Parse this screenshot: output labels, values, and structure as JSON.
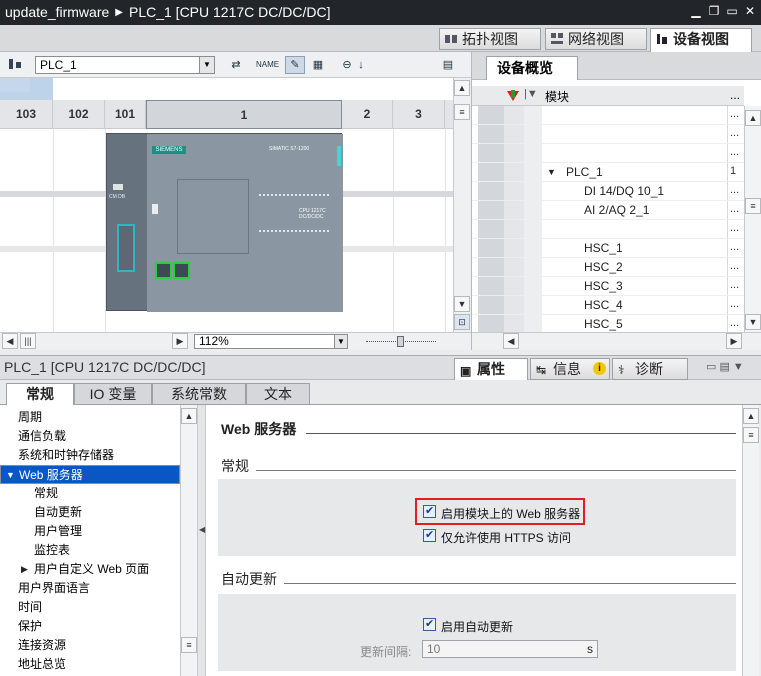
{
  "title_bar": {
    "project": "update_firmware",
    "sep": "▶",
    "device": "PLC_1 [CPU 1217C DC/DC/DC]"
  },
  "view_tabs": [
    {
      "label": "拓扑视图"
    },
    {
      "label": "网络视图"
    },
    {
      "label": "设备视图"
    }
  ],
  "toolbar": {
    "device_select": "PLC_1",
    "zoom": "112%"
  },
  "slots": [
    "103",
    "102",
    "101",
    "1",
    "2",
    "3"
  ],
  "plc_module": {
    "brand": "SIEMENS",
    "model": "SIMATIC S7-1200",
    "cpu_text": "CPU 1217C\nDC/DC/DC"
  },
  "overview": {
    "tab": "设备概览",
    "columns": {
      "module": "模块",
      "more": "..."
    },
    "rows": [
      {
        "name": "",
        "val": "..."
      },
      {
        "name": "",
        "val": "..."
      },
      {
        "name": "",
        "val": "..."
      },
      {
        "name": "PLC_1",
        "val": "1",
        "expand": "▼"
      },
      {
        "name": "DI 14/DQ 10_1",
        "val": "..."
      },
      {
        "name": "AI 2/AQ 2_1",
        "val": "..."
      },
      {
        "name": "",
        "val": "..."
      },
      {
        "name": "HSC_1",
        "val": "..."
      },
      {
        "name": "HSC_2",
        "val": "..."
      },
      {
        "name": "HSC_3",
        "val": "..."
      },
      {
        "name": "HSC_4",
        "val": "..."
      },
      {
        "name": "HSC_5",
        "val": "..."
      }
    ]
  },
  "props": {
    "title": "PLC_1 [CPU 1217C DC/DC/DC]",
    "tabs": [
      {
        "label": "属性"
      },
      {
        "label": "信息"
      },
      {
        "label": "诊断"
      }
    ],
    "subtabs": [
      {
        "label": "常规"
      },
      {
        "label": "IO 变量"
      },
      {
        "label": "系统常数"
      },
      {
        "label": "文本"
      }
    ]
  },
  "tree": [
    {
      "label": "周期",
      "indent": 0
    },
    {
      "label": "通信负载",
      "indent": 0
    },
    {
      "label": "系统和时钟存储器",
      "indent": 0
    },
    {
      "label": "Web 服务器",
      "indent": 0,
      "expand": "▼",
      "selected": true
    },
    {
      "label": "常规",
      "indent": 1
    },
    {
      "label": "自动更新",
      "indent": 1
    },
    {
      "label": "用户管理",
      "indent": 1
    },
    {
      "label": "监控表",
      "indent": 1
    },
    {
      "label": "用户自定义 Web 页面",
      "indent": 0,
      "expand": "▶"
    },
    {
      "label": "用户界面语言",
      "indent": 0
    },
    {
      "label": "时间",
      "indent": 0
    },
    {
      "label": "保护",
      "indent": 0
    },
    {
      "label": "连接资源",
      "indent": 0
    },
    {
      "label": "地址总览",
      "indent": 0
    }
  ],
  "content": {
    "heading": "Web 服务器",
    "general": {
      "heading": "常规",
      "enable_web": "启用模块上的 Web 服务器",
      "https_only": "仅允许使用 HTTPS 访问"
    },
    "auto_update": {
      "heading": "自动更新",
      "enable_auto": "启用自动更新",
      "interval_label": "更新间隔:",
      "interval_value": "10",
      "interval_unit": "s"
    }
  }
}
